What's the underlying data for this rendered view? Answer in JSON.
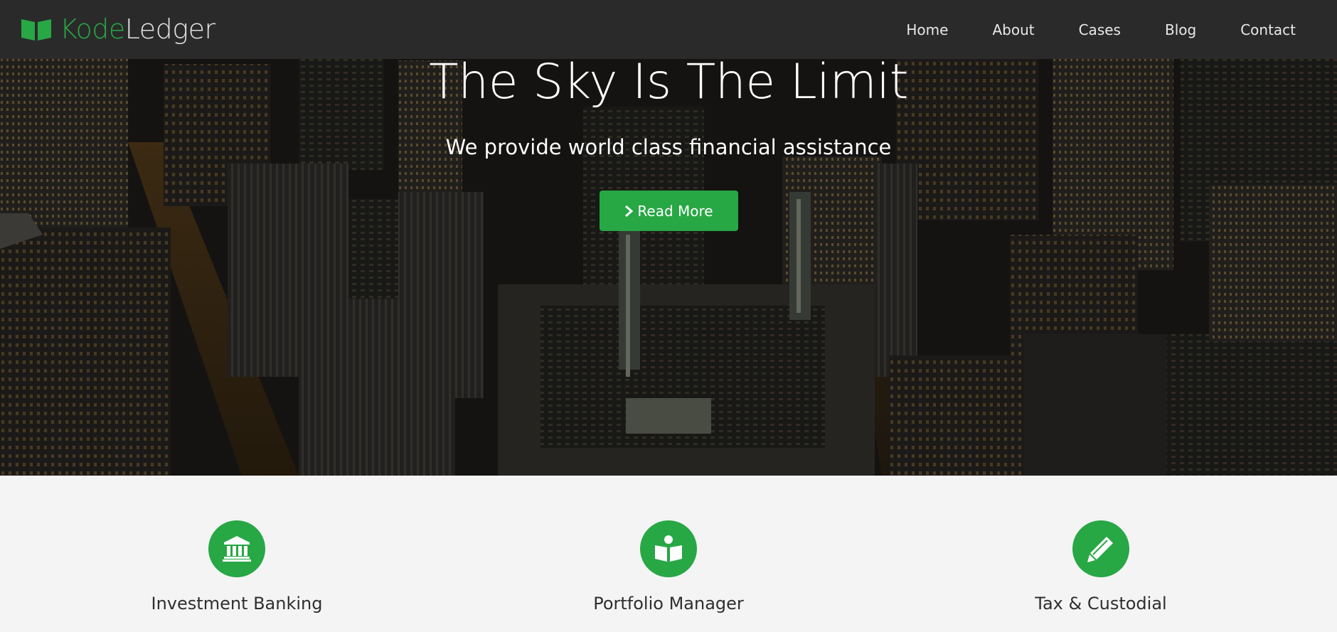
{
  "brand": {
    "name_part1": "Kode",
    "name_part2": "Ledger",
    "icon": "open-book-icon"
  },
  "nav": {
    "items": [
      {
        "label": "Home"
      },
      {
        "label": "About"
      },
      {
        "label": "Cases"
      },
      {
        "label": "Blog"
      },
      {
        "label": "Contact"
      }
    ]
  },
  "hero": {
    "title": "The Sky Is The Limit",
    "subtitle": "We provide world class financial assistance",
    "button_label": "Read More",
    "button_icon": "chevron-right-icon",
    "background": "night-city-aerial"
  },
  "features": [
    {
      "label": "Investment Banking",
      "icon": "bank-icon"
    },
    {
      "label": "Portfolio Manager",
      "icon": "reader-icon"
    },
    {
      "label": "Tax & Custodial",
      "icon": "pencil-icon"
    }
  ],
  "colors": {
    "accent": "#28a745",
    "navbar": "#2c2c2c",
    "features_bg": "#f4f4f4",
    "text_dark": "#2f2f2f"
  }
}
